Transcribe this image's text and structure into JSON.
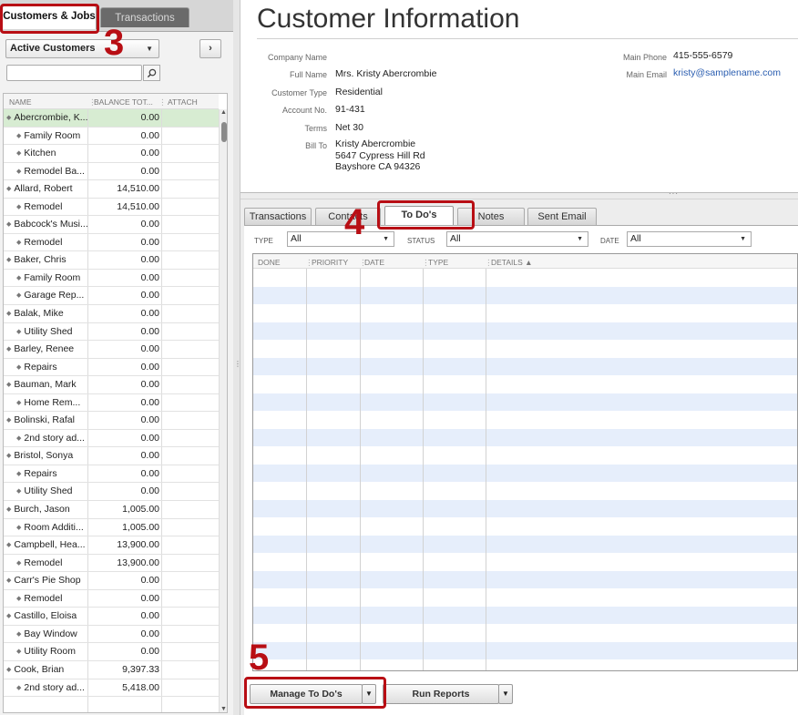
{
  "left_tabs": {
    "customers_jobs": "Customers & Jobs",
    "transactions": "Transactions"
  },
  "filter": {
    "selected": "Active Customers",
    "expand": "›"
  },
  "search": {
    "value": ""
  },
  "list_header": {
    "name": "NAME",
    "balance": "BALANCE TOT...",
    "attach": "ATTACH"
  },
  "customers": [
    {
      "name": "Abercrombie, K...",
      "balance": "0.00",
      "sub": false,
      "selected": true
    },
    {
      "name": "Family Room",
      "balance": "0.00",
      "sub": true
    },
    {
      "name": "Kitchen",
      "balance": "0.00",
      "sub": true
    },
    {
      "name": "Remodel Ba...",
      "balance": "0.00",
      "sub": true
    },
    {
      "name": "Allard, Robert",
      "balance": "14,510.00",
      "sub": false
    },
    {
      "name": "Remodel",
      "balance": "14,510.00",
      "sub": true
    },
    {
      "name": "Babcock's Musi...",
      "balance": "0.00",
      "sub": false
    },
    {
      "name": "Remodel",
      "balance": "0.00",
      "sub": true
    },
    {
      "name": "Baker, Chris",
      "balance": "0.00",
      "sub": false
    },
    {
      "name": "Family Room",
      "balance": "0.00",
      "sub": true
    },
    {
      "name": "Garage Rep...",
      "balance": "0.00",
      "sub": true
    },
    {
      "name": "Balak, Mike",
      "balance": "0.00",
      "sub": false
    },
    {
      "name": "Utility Shed",
      "balance": "0.00",
      "sub": true
    },
    {
      "name": "Barley, Renee",
      "balance": "0.00",
      "sub": false
    },
    {
      "name": "Repairs",
      "balance": "0.00",
      "sub": true
    },
    {
      "name": "Bauman, Mark",
      "balance": "0.00",
      "sub": false
    },
    {
      "name": "Home Rem...",
      "balance": "0.00",
      "sub": true
    },
    {
      "name": "Bolinski, Rafal",
      "balance": "0.00",
      "sub": false
    },
    {
      "name": "2nd story ad...",
      "balance": "0.00",
      "sub": true
    },
    {
      "name": "Bristol, Sonya",
      "balance": "0.00",
      "sub": false
    },
    {
      "name": "Repairs",
      "balance": "0.00",
      "sub": true
    },
    {
      "name": "Utility Shed",
      "balance": "0.00",
      "sub": true
    },
    {
      "name": "Burch, Jason",
      "balance": "1,005.00",
      "sub": false
    },
    {
      "name": "Room Additi...",
      "balance": "1,005.00",
      "sub": true
    },
    {
      "name": "Campbell, Hea...",
      "balance": "13,900.00",
      "sub": false
    },
    {
      "name": "Remodel",
      "balance": "13,900.00",
      "sub": true
    },
    {
      "name": "Carr's Pie Shop",
      "balance": "0.00",
      "sub": false
    },
    {
      "name": "Remodel",
      "balance": "0.00",
      "sub": true
    },
    {
      "name": "Castillo, Eloisa",
      "balance": "0.00",
      "sub": false
    },
    {
      "name": "Bay Window",
      "balance": "0.00",
      "sub": true
    },
    {
      "name": "Utility Room",
      "balance": "0.00",
      "sub": true
    },
    {
      "name": "Cook, Brian",
      "balance": "9,397.33",
      "sub": false
    },
    {
      "name": "2nd story ad...",
      "balance": "5,418.00",
      "sub": true
    },
    {
      "name": "",
      "balance": "",
      "sub": false
    }
  ],
  "title": "Customer Information",
  "info": {
    "company_name_label": "Company Name",
    "company_name": "",
    "full_name_label": "Full Name",
    "full_name": "Mrs. Kristy  Abercrombie",
    "customer_type_label": "Customer Type",
    "customer_type": "Residential",
    "account_no_label": "Account No.",
    "account_no": "91-431",
    "terms_label": "Terms",
    "terms": "Net 30",
    "bill_to_label": "Bill To",
    "bill_to_lines": [
      "Kristy Abercrombie",
      "5647 Cypress Hill Rd",
      "Bayshore CA 94326"
    ],
    "main_phone_label": "Main Phone",
    "main_phone": "415-555-6579",
    "main_email_label": "Main Email",
    "main_email": "kristy@samplename.com"
  },
  "tabs": {
    "transactions": "Transactions",
    "contacts": "Contacts",
    "todos": "To Do's",
    "notes": "Notes",
    "sent_email": "Sent Email"
  },
  "filters": {
    "type_label": "TYPE",
    "type_value": "All",
    "status_label": "STATUS",
    "status_value": "All",
    "date_label": "DATE",
    "date_value": "All"
  },
  "grid_header": {
    "done": "DONE",
    "priority": "PRIORITY",
    "date": "DATE",
    "type": "TYPE",
    "details": "DETAILS ▲"
  },
  "buttons": {
    "manage_todos": "Manage To Do's",
    "run_reports": "Run Reports"
  },
  "annotations": {
    "step3": "3",
    "step4": "4",
    "step5": "5"
  },
  "colors": {
    "annotation": "#b80e14",
    "selected_row": "#d7ecd2",
    "stripe": "#e6eefb",
    "link": "#2a5db0"
  }
}
